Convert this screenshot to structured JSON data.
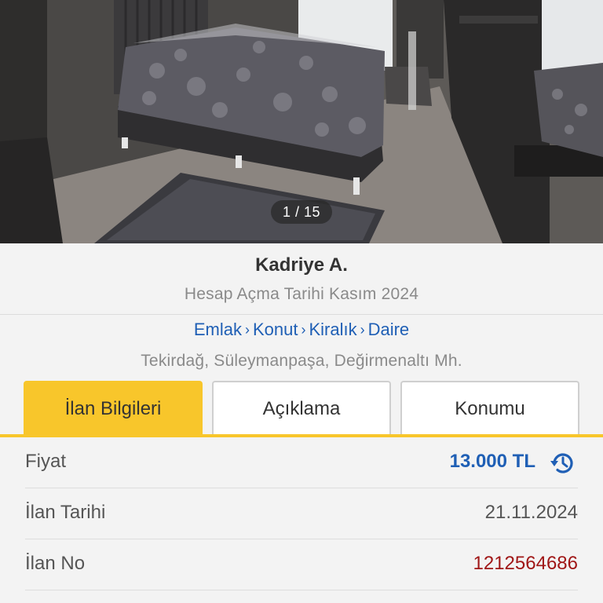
{
  "gallery": {
    "counter": "1 / 15"
  },
  "owner": {
    "name": "Kadriye A.",
    "since": "Hesap Açma Tarihi Kasım 2024"
  },
  "breadcrumb": {
    "items": [
      "Emlak",
      "Konut",
      "Kiralık",
      "Daire"
    ],
    "separator": "›"
  },
  "location": "Tekirdağ, Süleymanpaşa, Değirmenaltı Mh.",
  "tabs": [
    {
      "label": "İlan Bilgileri",
      "active": true
    },
    {
      "label": "Açıklama",
      "active": false
    },
    {
      "label": "Konumu",
      "active": false
    }
  ],
  "details": [
    {
      "label": "Fiyat",
      "value": "13.000 TL"
    },
    {
      "label": "İlan Tarihi",
      "value": "21.11.2024"
    },
    {
      "label": "İlan No",
      "value": "1212564686"
    }
  ],
  "colors": {
    "accent_yellow": "#f8c62b",
    "link_blue": "#1f5fb5",
    "listing_no_red": "#a01717",
    "muted_text": "#8a8a8a"
  },
  "icons": {
    "price_history": "history-icon"
  }
}
